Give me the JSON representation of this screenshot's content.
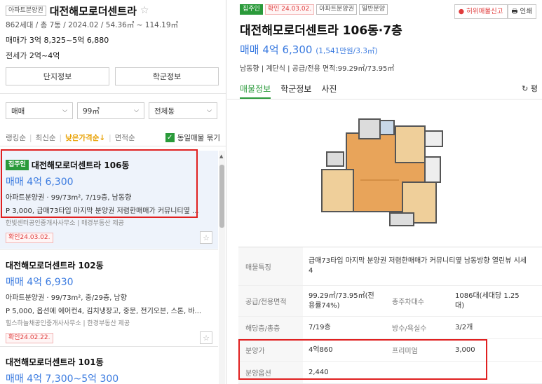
{
  "left": {
    "tag": "아파트분양권",
    "name": "대전해모로더센트라",
    "meta": "862세대 / 총 7동 / 2024.02 / 54.36㎡ ~ 114.19㎡",
    "sale_label": "매매가",
    "sale_value": "3억 8,325~5억 6,880",
    "rent_label": "전세가",
    "rent_value": "2억~4억",
    "btn_complex": "단지정보",
    "btn_school": "학군정보",
    "filter_type": "매매",
    "filter_area": "99㎡",
    "filter_dong": "전체동",
    "sort_rank": "랭킹순",
    "sort_new": "최신순",
    "sort_price": "낮은가격순↓",
    "sort_area": "면적순",
    "same_listing": "동일매물 묶기",
    "items": [
      {
        "badge": "집주인",
        "title": "대전해모로더센트라 106동",
        "price": "매매 4억 6,300",
        "line1": "아파트분양권 · 99/73m², 7/19층, 남동향",
        "line2": "P 3,000, 급매73타입 마지막 분양권 저렴한매매가 커뮤니티옆 ...",
        "source": "한빛센터공인중개사사무소 | 매경부동산 제공",
        "confirm": "확인24.03.02."
      },
      {
        "title": "대전해모로더센트라 102동",
        "price": "매매 4억 6,930",
        "line1": "아파트분양권 · 99/73m², 중/29층, 남향",
        "line2": "P 5,000, 옵션에 에어컨4, 김치냉장고, 중문, 전기오븐, 스톤, 바...",
        "source": "힐스하늘채공인중개사사무소 | 한경부동산 제공",
        "confirm": "확인24.02.22."
      },
      {
        "title": "대전해모로더센트라 101동",
        "price": "매매 4억 7,300~5억 300"
      }
    ]
  },
  "right": {
    "badge_owner": "집주인",
    "badge_confirm": "확인 24.03.02.",
    "badge_type": "아파트분양권",
    "badge_sale": "일반분양",
    "report": "● 허위매물신고",
    "print": "🖶 인쇄",
    "title": "대전해모로더센트라 106동·7층",
    "price": "매매 4억 6,300",
    "price_unit": "(1,541만원/3.3㎡)",
    "meta": "남동향 | 계단식 | 공급/전용 면적:99.29㎡/73.95㎡",
    "tab_listing": "매물정보",
    "tab_school": "학군정보",
    "tab_photo": "사진",
    "share": "↻ 평",
    "table": {
      "feature_label": "매물특징",
      "feature_value": "급매73타입 마지막 분양권 저렴한매매가 커뮤니티옆 남동방향 열린뷰 시세4",
      "area_label": "공급/전용면적",
      "area_value": "99.29㎡/73.95㎡(전용률74%)",
      "households_label": "총주차대수",
      "households_value": "1086대(세대당 1.25대)",
      "floor_label": "해당층/총층",
      "floor_value": "7/19층",
      "rooms_label": "방수/욕실수",
      "rooms_value": "3/2개",
      "sale_price_label": "분양가",
      "sale_price_value": "4억860",
      "premium_label": "프리미엄",
      "premium_value": "3,000",
      "option_label": "분양옵션",
      "option_value": "2,440"
    }
  },
  "colors": {
    "green": "#2a9a3a",
    "blue": "#3b7be0",
    "red": "#e02020"
  }
}
